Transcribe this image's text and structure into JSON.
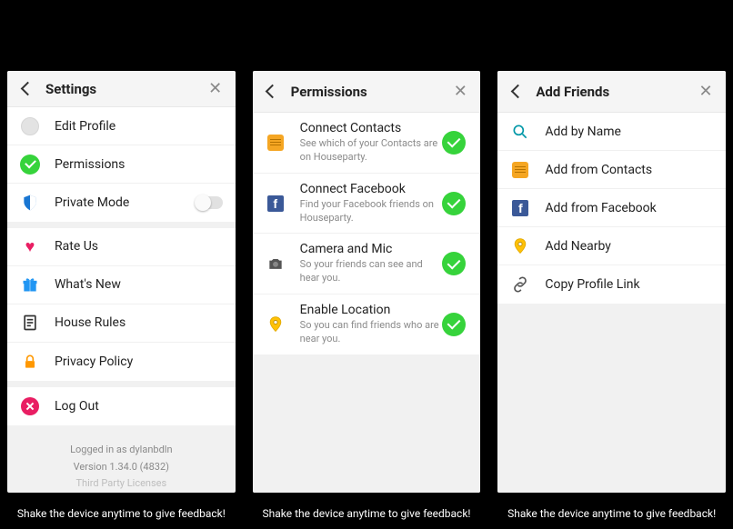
{
  "shake_text": "Shake the device anytime to give feedback!",
  "settings": {
    "title": "Settings",
    "items": {
      "edit_profile": "Edit Profile",
      "permissions": "Permissions",
      "private_mode": "Private Mode",
      "rate_us": "Rate Us",
      "whats_new": "What's New",
      "house_rules": "House Rules",
      "privacy_policy": "Privacy Policy",
      "log_out": "Log Out"
    },
    "footer": {
      "logged_in": "Logged in as dylanbdln",
      "version": "Version 1.34.0 (4832)",
      "third_party": "Third Party Licenses"
    }
  },
  "permissions": {
    "title": "Permissions",
    "rows": [
      {
        "label": "Connect Contacts",
        "sub": "See which of your Contacts are on Houseparty."
      },
      {
        "label": "Connect Facebook",
        "sub": "Find your Facebook friends on Houseparty."
      },
      {
        "label": "Camera and Mic",
        "sub": "So your friends can see and hear you."
      },
      {
        "label": "Enable Location",
        "sub": "So you can find friends who are near you."
      }
    ]
  },
  "add_friends": {
    "title": "Add Friends",
    "rows": [
      "Add by Name",
      "Add from Contacts",
      "Add from Facebook",
      "Add Nearby",
      "Copy Profile Link"
    ]
  }
}
